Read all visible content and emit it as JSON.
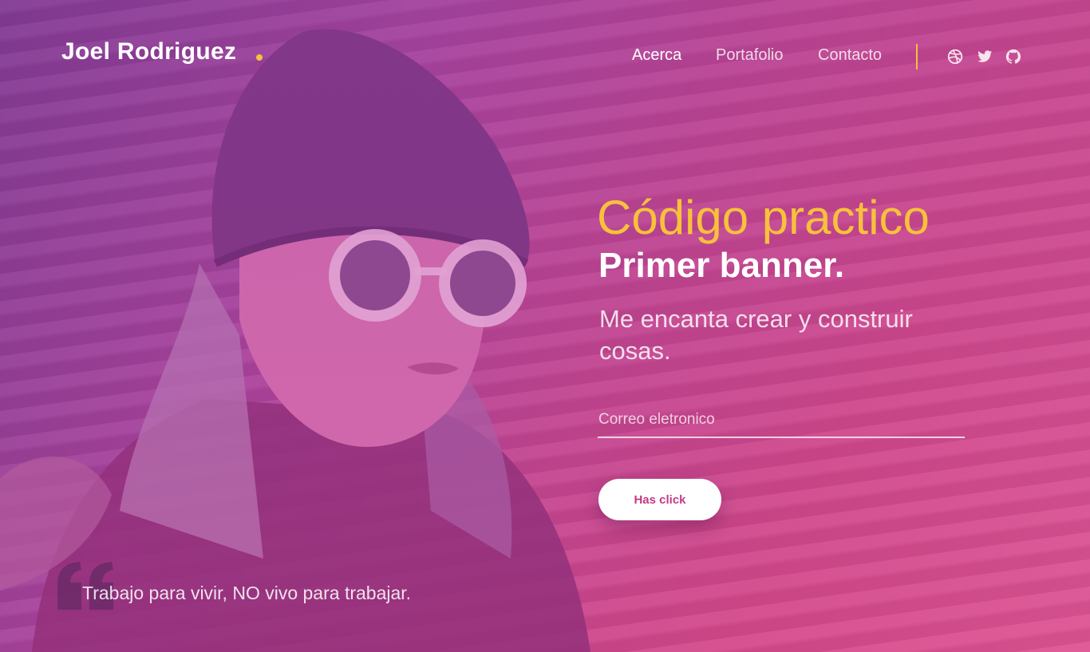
{
  "nav": {
    "logo": "Joel Rodriguez",
    "menu": [
      {
        "label": "Acerca",
        "active": true
      },
      {
        "label": "Portafolio",
        "active": false
      },
      {
        "label": "Contacto",
        "active": false
      }
    ],
    "social_icons": [
      "dribbble-icon",
      "twitter-icon",
      "github-icon"
    ]
  },
  "hero": {
    "title": "Código practico",
    "subtitle": "Primer banner.",
    "text": "Me encanta crear y construir cosas.",
    "email_placeholder": "Correo eletronico",
    "button_label": "Has click"
  },
  "quote": {
    "text": "Trabajo para vivir, NO vivo para trabajar."
  },
  "colors": {
    "accent": "#f7c13b",
    "gradient_start": "#7a3a8f",
    "gradient_end": "#e05694",
    "button_text": "#c43a86"
  }
}
